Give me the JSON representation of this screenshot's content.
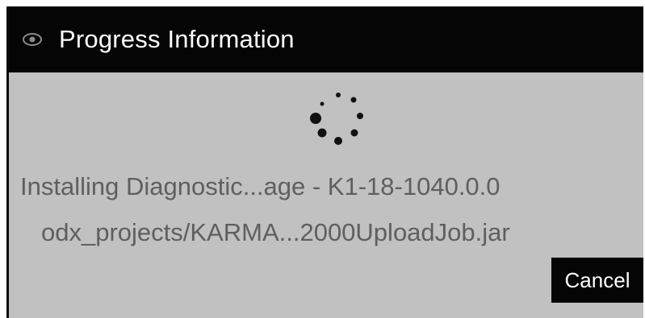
{
  "dialog": {
    "title": "Progress Information",
    "title_icon": "eye-icon",
    "spinner_icon": "loading-spinner-icon",
    "status_line_1": "Installing Diagnostic...age - K1-18-1040.0.0",
    "status_line_2": "odx_projects/KARMA...2000UploadJob.jar",
    "cancel_label": "Cancel"
  },
  "colors": {
    "titlebar": "#050505",
    "body": "#c1c1c1",
    "status_text": "#5f5f5f",
    "button": "#050505"
  }
}
